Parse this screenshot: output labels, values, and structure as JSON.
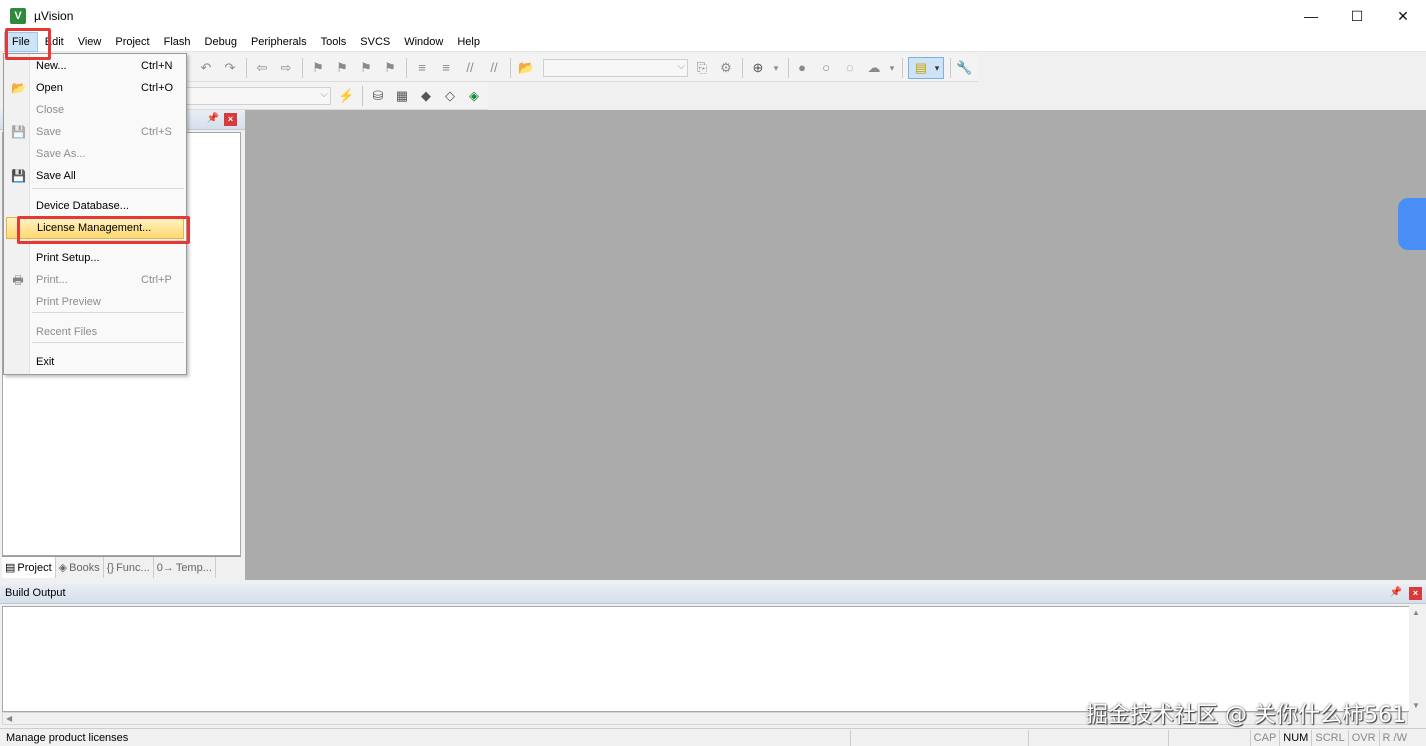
{
  "window": {
    "title": "µVision",
    "app_icon": "V",
    "minimize": "—",
    "maximize": "☐",
    "close": "✕"
  },
  "menubar": [
    "File",
    "Edit",
    "View",
    "Project",
    "Flash",
    "Debug",
    "Peripherals",
    "Tools",
    "SVCS",
    "Window",
    "Help"
  ],
  "file_menu": {
    "items": [
      {
        "label": "New...",
        "shortcut": "Ctrl+N",
        "icon": "new-file-icon",
        "glyph": "",
        "enabled": true
      },
      {
        "label": "Open",
        "shortcut": "Ctrl+O",
        "icon": "open-folder-icon",
        "glyph": "📂",
        "enabled": true
      },
      {
        "label": "Close",
        "shortcut": "",
        "icon": "",
        "glyph": "",
        "enabled": false
      },
      {
        "label": "Save",
        "shortcut": "Ctrl+S",
        "icon": "save-icon",
        "glyph": "💾",
        "enabled": false
      },
      {
        "label": "Save As...",
        "shortcut": "",
        "icon": "",
        "glyph": "",
        "enabled": false
      },
      {
        "label": "Save All",
        "shortcut": "",
        "icon": "save-all-icon",
        "glyph": "💾",
        "enabled": true
      },
      {
        "label": "Device Database...",
        "shortcut": "",
        "icon": "",
        "glyph": "",
        "enabled": true
      },
      {
        "label": "License Management...",
        "shortcut": "",
        "icon": "",
        "glyph": "",
        "enabled": true
      },
      {
        "label": "Print Setup...",
        "shortcut": "",
        "icon": "",
        "glyph": "",
        "enabled": true
      },
      {
        "label": "Print...",
        "shortcut": "Ctrl+P",
        "icon": "print-icon",
        "glyph": "🖶",
        "enabled": false
      },
      {
        "label": "Print Preview",
        "shortcut": "",
        "icon": "",
        "glyph": "",
        "enabled": false
      },
      {
        "label": "Recent Files",
        "shortcut": "",
        "icon": "",
        "glyph": "",
        "enabled": false
      },
      {
        "label": "Exit",
        "shortcut": "",
        "icon": "",
        "glyph": "",
        "enabled": true
      }
    ]
  },
  "project_panel": {
    "tabs": [
      {
        "label": "Project",
        "glyph": "▤",
        "icon": "project-tab-icon"
      },
      {
        "label": "Books",
        "glyph": "◈",
        "icon": "books-tab-icon"
      },
      {
        "label": "Func...",
        "glyph": "{}",
        "icon": "functions-tab-icon"
      },
      {
        "label": "Temp...",
        "glyph": "0→",
        "icon": "templates-tab-icon"
      }
    ]
  },
  "build_output": {
    "title": "Build Output"
  },
  "statusbar": {
    "text": "Manage product licenses",
    "indicators": [
      "CAP",
      "NUM",
      "SCRL",
      "OVR",
      "R /W"
    ],
    "active": "NUM"
  },
  "watermark": "掘金技术社区 @ 关你什么柿561",
  "colors": {
    "highlight": "#ffd870",
    "annotation": "#e53935",
    "editor_bg": "#ababab"
  }
}
